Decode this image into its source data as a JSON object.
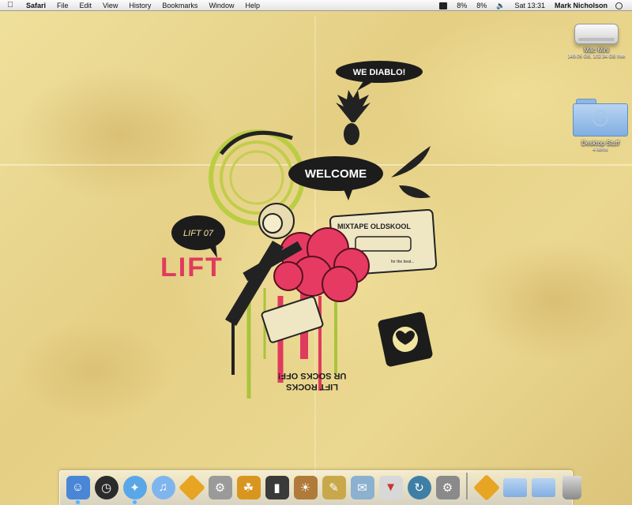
{
  "menubar": {
    "apple_icon": "apple-icon",
    "app_name": "Safari",
    "items": [
      "File",
      "Edit",
      "View",
      "History",
      "Bookmarks",
      "Window",
      "Help"
    ],
    "status": {
      "battery_icon_label": "8%",
      "battery_percent": "8%",
      "clock": "Sat 13:31",
      "user": "Mark Nicholson"
    }
  },
  "desktop": {
    "icons": [
      {
        "label": "Mac Mini",
        "subtitle": "149.05 GB, 102.34 GB free"
      },
      {
        "label": "Desktop Stuff",
        "subtitle": "4 items"
      }
    ]
  },
  "artwork": {
    "speech_top": "WE DIABLO!",
    "speech_welcome": "WELCOME",
    "speech_lift": "LIFT 07",
    "lift_text": "LIFT",
    "tape_label": "MIXTAPE OLDSKOOL",
    "tape_sub": "for the beat...",
    "slogan_1": "LIFT ROCKS",
    "slogan_2": "UR SOCKS OFF!"
  },
  "dock": {
    "items": [
      {
        "name": "finder-icon",
        "color": "#4a86d6",
        "running": true
      },
      {
        "name": "dashboard-icon",
        "color": "#2b2b2b",
        "running": false
      },
      {
        "name": "safari-icon",
        "color": "#5aa7e8",
        "running": true
      },
      {
        "name": "itunes-icon",
        "color": "#7fb5ef",
        "running": false
      },
      {
        "name": "transmit-icon",
        "color": "#e8a423",
        "running": false
      },
      {
        "name": "automator-icon",
        "color": "#9a9a9a",
        "running": false
      },
      {
        "name": "adium-icon",
        "color": "#d9961f",
        "running": false
      },
      {
        "name": "quicktime-icon",
        "color": "#3a3a3a",
        "running": false
      },
      {
        "name": "iphoto-icon",
        "color": "#b07a3a",
        "running": false
      },
      {
        "name": "textedit-icon",
        "color": "#c8a84a",
        "running": false
      },
      {
        "name": "mail-icon",
        "color": "#8cb0cf",
        "running": false
      },
      {
        "name": "transmission-icon",
        "color": "#d8d8d8",
        "running": false
      },
      {
        "name": "time-machine-icon",
        "color": "#3f7fa5",
        "running": false
      },
      {
        "name": "system-preferences-icon",
        "color": "#8a8a8a",
        "running": false
      }
    ],
    "right_items": [
      {
        "name": "downloads-stack-icon",
        "color": "#e8a423"
      },
      {
        "name": "documents-folder-icon",
        "color": "#8fb7e4"
      },
      {
        "name": "applications-folder-icon",
        "color": "#8fb7e4"
      },
      {
        "name": "trash-icon",
        "color": "#9a9a9a"
      }
    ]
  }
}
